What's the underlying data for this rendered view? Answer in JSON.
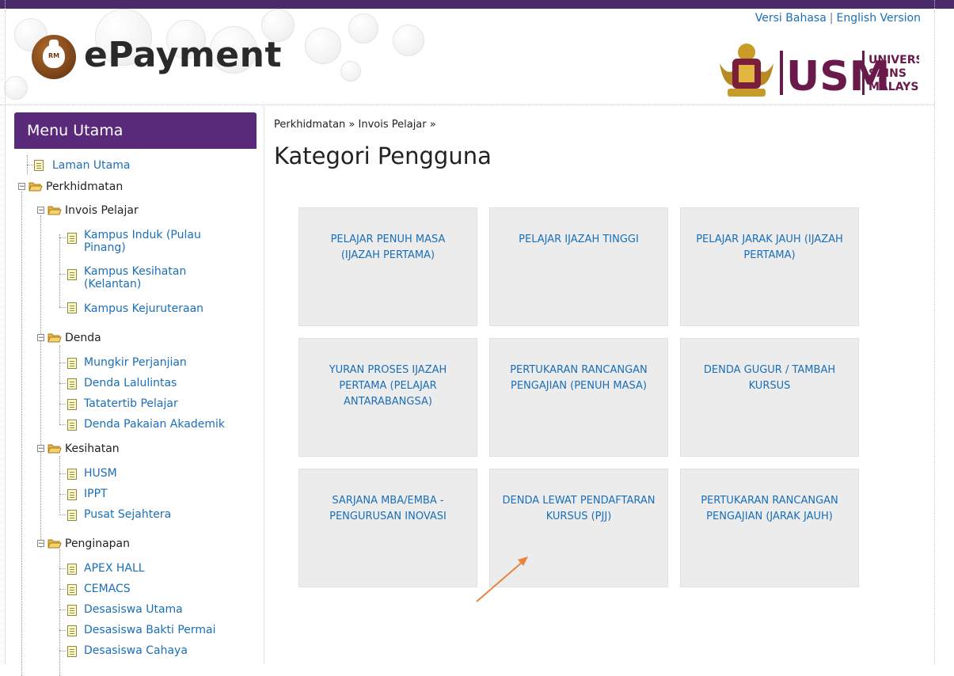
{
  "header": {
    "brand": "ePayment",
    "brand_icon_text": "RM",
    "lang_malay": "Versi Bahasa",
    "lang_separator": "|",
    "lang_english": "English Version",
    "university": [
      "UNIVERSITI",
      "SAINS",
      "MALAYSIA"
    ],
    "usm_mark": "USM"
  },
  "menu": {
    "title": "Menu Utama",
    "home": "Laman Utama",
    "services": "Perkhidmatan",
    "invois": "Invois Pelajar",
    "invois_items": [
      "Kampus Induk (Pulau Pinang)",
      "Kampus Kesihatan (Kelantan)",
      "Kampus Kejuruteraan"
    ],
    "denda": "Denda",
    "denda_items": [
      "Mungkir Perjanjian",
      "Denda Lalulintas",
      "Tatatertib Pelajar",
      "Denda Pakaian Akademik"
    ],
    "kesihatan": "Kesihatan",
    "kesihatan_items": [
      "HUSM",
      "IPPT",
      "Pusat Sejahtera"
    ],
    "penginapan": "Penginapan",
    "penginapan_items": [
      "APEX HALL",
      "CEMACS",
      "Desasiswa Utama",
      "Desasiswa Bakti Permai",
      "Desasiswa Cahaya"
    ]
  },
  "main": {
    "breadcrumb": "Perkhidmatan » Invois Pelajar »",
    "title": "Kategori Pengguna",
    "cards": [
      "PELAJAR PENUH MASA (IJAZAH PERTAMA)",
      "PELAJAR IJAZAH TINGGI",
      "PELAJAR JARAK JAUH (IJAZAH PERTAMA)",
      "YURAN PROSES IJAZAH PERTAMA (PELAJAR ANTARABANGSA)",
      "PERTUKARAN RANCANGAN PENGAJIAN (PENUH MASA)",
      "DENDA GUGUR / TAMBAH KURSUS",
      "SARJANA MBA/EMBA - PENGURUSAN INOVASI",
      "DENDA LEWAT PENDAFTARAN KURSUS (PJJ)",
      "PERTUKARAN RANCANGAN PENGAJIAN (JARAK JAUH)"
    ]
  },
  "colors": {
    "purple": "#5a2a7a",
    "link": "#1a6fb8",
    "card_bg": "#ececec",
    "arrow": "#e8843a"
  }
}
